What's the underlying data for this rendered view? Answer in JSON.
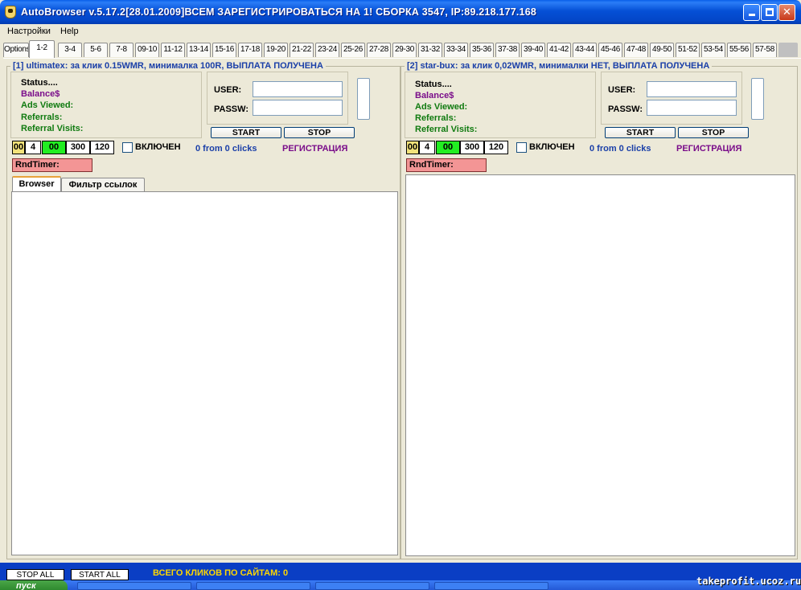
{
  "window": {
    "title": "AutoBrowser v.5.17.2[28.01.2009]ВСЕМ ЗАРЕГИСТРИРОВАТЬСЯ НА 1! СБОРКА 3547, IP:89.218.177.168"
  },
  "menu": [
    "Настройки",
    "Help"
  ],
  "tabs": [
    "Options",
    "1-2",
    "3-4",
    "5-6",
    "7-8",
    "09-10",
    "11-12",
    "13-14",
    "15-16",
    "17-18",
    "19-20",
    "21-22",
    "23-24",
    "25-26",
    "27-28",
    "29-30",
    "31-32",
    "33-34",
    "35-36",
    "37-38",
    "39-40",
    "41-42",
    "43-44",
    "45-46",
    "47-48",
    "49-50",
    "51-52",
    "53-54",
    "55-56",
    "57-58"
  ],
  "active_tab": "1-2",
  "stats_labels": {
    "status": "Status....",
    "balance": "Balance$",
    "ads": "Ads Viewed:",
    "referrals": "Referrals:",
    "visits": "Referral Visits:"
  },
  "login": {
    "user_label": "USER:",
    "pass_label": "PASSW:",
    "user_value": "",
    "pass_value": "",
    "start": "START",
    "stop": "STOP"
  },
  "controls": {
    "yellow_value": "00",
    "count_value": "4",
    "green_value": "00",
    "value_300": "300",
    "value_120": "120",
    "enable_label": "ВКЛЮЧЕН",
    "clicks": "0 from 0 clicks",
    "register": "РЕГИСТРАЦИЯ",
    "rnd_timer": "RndTimer:"
  },
  "sites": [
    {
      "title": "[1] ultimatex: за клик 0.15WMR, минималка 100R, ВЫПЛАТА ПОЛУЧЕНА"
    },
    {
      "title": "[2] star-bux: за клик 0,02WMR, минималки НЕТ, ВЫПЛАТА ПОЛУЧЕНА"
    }
  ],
  "subtabs": [
    "Browser",
    "Фильтр ссылок"
  ],
  "bottom": {
    "stop_all": "STOP ALL",
    "start_all": "START ALL",
    "total": "ВСЕГО КЛИКОВ ПО САЙТАМ: 0"
  },
  "watermark": "takeprofit.ucoz.ru",
  "taskbar": {
    "start": "пуск"
  },
  "colors": {
    "title_bar": "#0550d6",
    "legend_text": "#1a3fa8",
    "balance_text": "#7a0d8a",
    "green_text": "#0f7a0f",
    "rnd_timer_bg": "#f39595",
    "counter_yellow": "#f2e27a",
    "counter_green": "#22ee22",
    "bottom_bar": "#0a3ec4",
    "total_text": "#ffd700"
  }
}
